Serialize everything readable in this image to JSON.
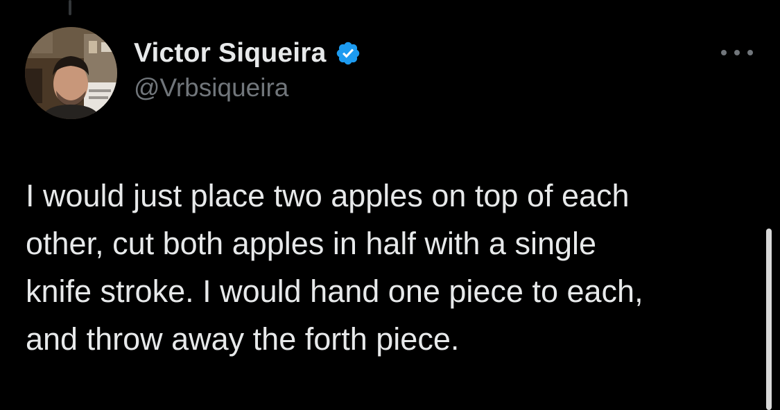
{
  "author": {
    "display_name": "Victor Siqueira",
    "handle": "@Vrbsiqueira",
    "verified": true,
    "verified_color": "#1d9bf0"
  },
  "tweet": {
    "text": "I would just place two apples on top of each\nother, cut both apples in half with a single\nknife stroke. I would hand one piece to each,\nand throw away the forth piece."
  },
  "icons": {
    "avatar": "profile-photo",
    "verified": "verified-badge-icon",
    "more": "more-options-icon"
  },
  "colors": {
    "background": "#000000",
    "text": "#e7e9ea",
    "secondary_text": "#71767b"
  }
}
